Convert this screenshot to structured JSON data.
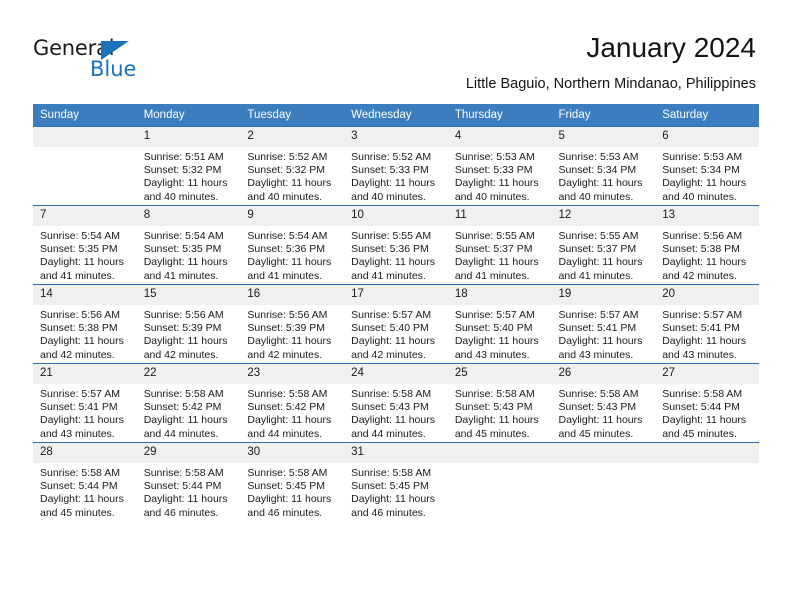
{
  "brand": {
    "name_part1": "General",
    "name_part2": "Blue",
    "accent_color": "#1b72bb"
  },
  "header": {
    "title": "January 2024",
    "subtitle": "Little Baguio, Northern Mindanao, Philippines"
  },
  "calendar": {
    "header_color": "#3b7dbf",
    "weekdays": [
      "Sunday",
      "Monday",
      "Tuesday",
      "Wednesday",
      "Thursday",
      "Friday",
      "Saturday"
    ],
    "labels": {
      "sunrise": "Sunrise:",
      "sunset": "Sunset:",
      "daylight": "Daylight:"
    },
    "weeks": [
      [
        {
          "day": "",
          "blank": true
        },
        {
          "day": "1",
          "sunrise": "Sunrise: 5:51 AM",
          "sunset": "Sunset: 5:32 PM",
          "daylight1": "Daylight: 11 hours",
          "daylight2": "and 40 minutes."
        },
        {
          "day": "2",
          "sunrise": "Sunrise: 5:52 AM",
          "sunset": "Sunset: 5:32 PM",
          "daylight1": "Daylight: 11 hours",
          "daylight2": "and 40 minutes."
        },
        {
          "day": "3",
          "sunrise": "Sunrise: 5:52 AM",
          "sunset": "Sunset: 5:33 PM",
          "daylight1": "Daylight: 11 hours",
          "daylight2": "and 40 minutes."
        },
        {
          "day": "4",
          "sunrise": "Sunrise: 5:53 AM",
          "sunset": "Sunset: 5:33 PM",
          "daylight1": "Daylight: 11 hours",
          "daylight2": "and 40 minutes."
        },
        {
          "day": "5",
          "sunrise": "Sunrise: 5:53 AM",
          "sunset": "Sunset: 5:34 PM",
          "daylight1": "Daylight: 11 hours",
          "daylight2": "and 40 minutes."
        },
        {
          "day": "6",
          "sunrise": "Sunrise: 5:53 AM",
          "sunset": "Sunset: 5:34 PM",
          "daylight1": "Daylight: 11 hours",
          "daylight2": "and 40 minutes."
        }
      ],
      [
        {
          "day": "7",
          "sunrise": "Sunrise: 5:54 AM",
          "sunset": "Sunset: 5:35 PM",
          "daylight1": "Daylight: 11 hours",
          "daylight2": "and 41 minutes."
        },
        {
          "day": "8",
          "sunrise": "Sunrise: 5:54 AM",
          "sunset": "Sunset: 5:35 PM",
          "daylight1": "Daylight: 11 hours",
          "daylight2": "and 41 minutes."
        },
        {
          "day": "9",
          "sunrise": "Sunrise: 5:54 AM",
          "sunset": "Sunset: 5:36 PM",
          "daylight1": "Daylight: 11 hours",
          "daylight2": "and 41 minutes."
        },
        {
          "day": "10",
          "sunrise": "Sunrise: 5:55 AM",
          "sunset": "Sunset: 5:36 PM",
          "daylight1": "Daylight: 11 hours",
          "daylight2": "and 41 minutes."
        },
        {
          "day": "11",
          "sunrise": "Sunrise: 5:55 AM",
          "sunset": "Sunset: 5:37 PM",
          "daylight1": "Daylight: 11 hours",
          "daylight2": "and 41 minutes."
        },
        {
          "day": "12",
          "sunrise": "Sunrise: 5:55 AM",
          "sunset": "Sunset: 5:37 PM",
          "daylight1": "Daylight: 11 hours",
          "daylight2": "and 41 minutes."
        },
        {
          "day": "13",
          "sunrise": "Sunrise: 5:56 AM",
          "sunset": "Sunset: 5:38 PM",
          "daylight1": "Daylight: 11 hours",
          "daylight2": "and 42 minutes."
        }
      ],
      [
        {
          "day": "14",
          "sunrise": "Sunrise: 5:56 AM",
          "sunset": "Sunset: 5:38 PM",
          "daylight1": "Daylight: 11 hours",
          "daylight2": "and 42 minutes."
        },
        {
          "day": "15",
          "sunrise": "Sunrise: 5:56 AM",
          "sunset": "Sunset: 5:39 PM",
          "daylight1": "Daylight: 11 hours",
          "daylight2": "and 42 minutes."
        },
        {
          "day": "16",
          "sunrise": "Sunrise: 5:56 AM",
          "sunset": "Sunset: 5:39 PM",
          "daylight1": "Daylight: 11 hours",
          "daylight2": "and 42 minutes."
        },
        {
          "day": "17",
          "sunrise": "Sunrise: 5:57 AM",
          "sunset": "Sunset: 5:40 PM",
          "daylight1": "Daylight: 11 hours",
          "daylight2": "and 42 minutes."
        },
        {
          "day": "18",
          "sunrise": "Sunrise: 5:57 AM",
          "sunset": "Sunset: 5:40 PM",
          "daylight1": "Daylight: 11 hours",
          "daylight2": "and 43 minutes."
        },
        {
          "day": "19",
          "sunrise": "Sunrise: 5:57 AM",
          "sunset": "Sunset: 5:41 PM",
          "daylight1": "Daylight: 11 hours",
          "daylight2": "and 43 minutes."
        },
        {
          "day": "20",
          "sunrise": "Sunrise: 5:57 AM",
          "sunset": "Sunset: 5:41 PM",
          "daylight1": "Daylight: 11 hours",
          "daylight2": "and 43 minutes."
        }
      ],
      [
        {
          "day": "21",
          "sunrise": "Sunrise: 5:57 AM",
          "sunset": "Sunset: 5:41 PM",
          "daylight1": "Daylight: 11 hours",
          "daylight2": "and 43 minutes."
        },
        {
          "day": "22",
          "sunrise": "Sunrise: 5:58 AM",
          "sunset": "Sunset: 5:42 PM",
          "daylight1": "Daylight: 11 hours",
          "daylight2": "and 44 minutes."
        },
        {
          "day": "23",
          "sunrise": "Sunrise: 5:58 AM",
          "sunset": "Sunset: 5:42 PM",
          "daylight1": "Daylight: 11 hours",
          "daylight2": "and 44 minutes."
        },
        {
          "day": "24",
          "sunrise": "Sunrise: 5:58 AM",
          "sunset": "Sunset: 5:43 PM",
          "daylight1": "Daylight: 11 hours",
          "daylight2": "and 44 minutes."
        },
        {
          "day": "25",
          "sunrise": "Sunrise: 5:58 AM",
          "sunset": "Sunset: 5:43 PM",
          "daylight1": "Daylight: 11 hours",
          "daylight2": "and 45 minutes."
        },
        {
          "day": "26",
          "sunrise": "Sunrise: 5:58 AM",
          "sunset": "Sunset: 5:43 PM",
          "daylight1": "Daylight: 11 hours",
          "daylight2": "and 45 minutes."
        },
        {
          "day": "27",
          "sunrise": "Sunrise: 5:58 AM",
          "sunset": "Sunset: 5:44 PM",
          "daylight1": "Daylight: 11 hours",
          "daylight2": "and 45 minutes."
        }
      ],
      [
        {
          "day": "28",
          "sunrise": "Sunrise: 5:58 AM",
          "sunset": "Sunset: 5:44 PM",
          "daylight1": "Daylight: 11 hours",
          "daylight2": "and 45 minutes."
        },
        {
          "day": "29",
          "sunrise": "Sunrise: 5:58 AM",
          "sunset": "Sunset: 5:44 PM",
          "daylight1": "Daylight: 11 hours",
          "daylight2": "and 46 minutes."
        },
        {
          "day": "30",
          "sunrise": "Sunrise: 5:58 AM",
          "sunset": "Sunset: 5:45 PM",
          "daylight1": "Daylight: 11 hours",
          "daylight2": "and 46 minutes."
        },
        {
          "day": "31",
          "sunrise": "Sunrise: 5:58 AM",
          "sunset": "Sunset: 5:45 PM",
          "daylight1": "Daylight: 11 hours",
          "daylight2": "and 46 minutes."
        },
        {
          "day": "",
          "blank": true
        },
        {
          "day": "",
          "blank": true
        },
        {
          "day": "",
          "blank": true
        }
      ]
    ]
  }
}
